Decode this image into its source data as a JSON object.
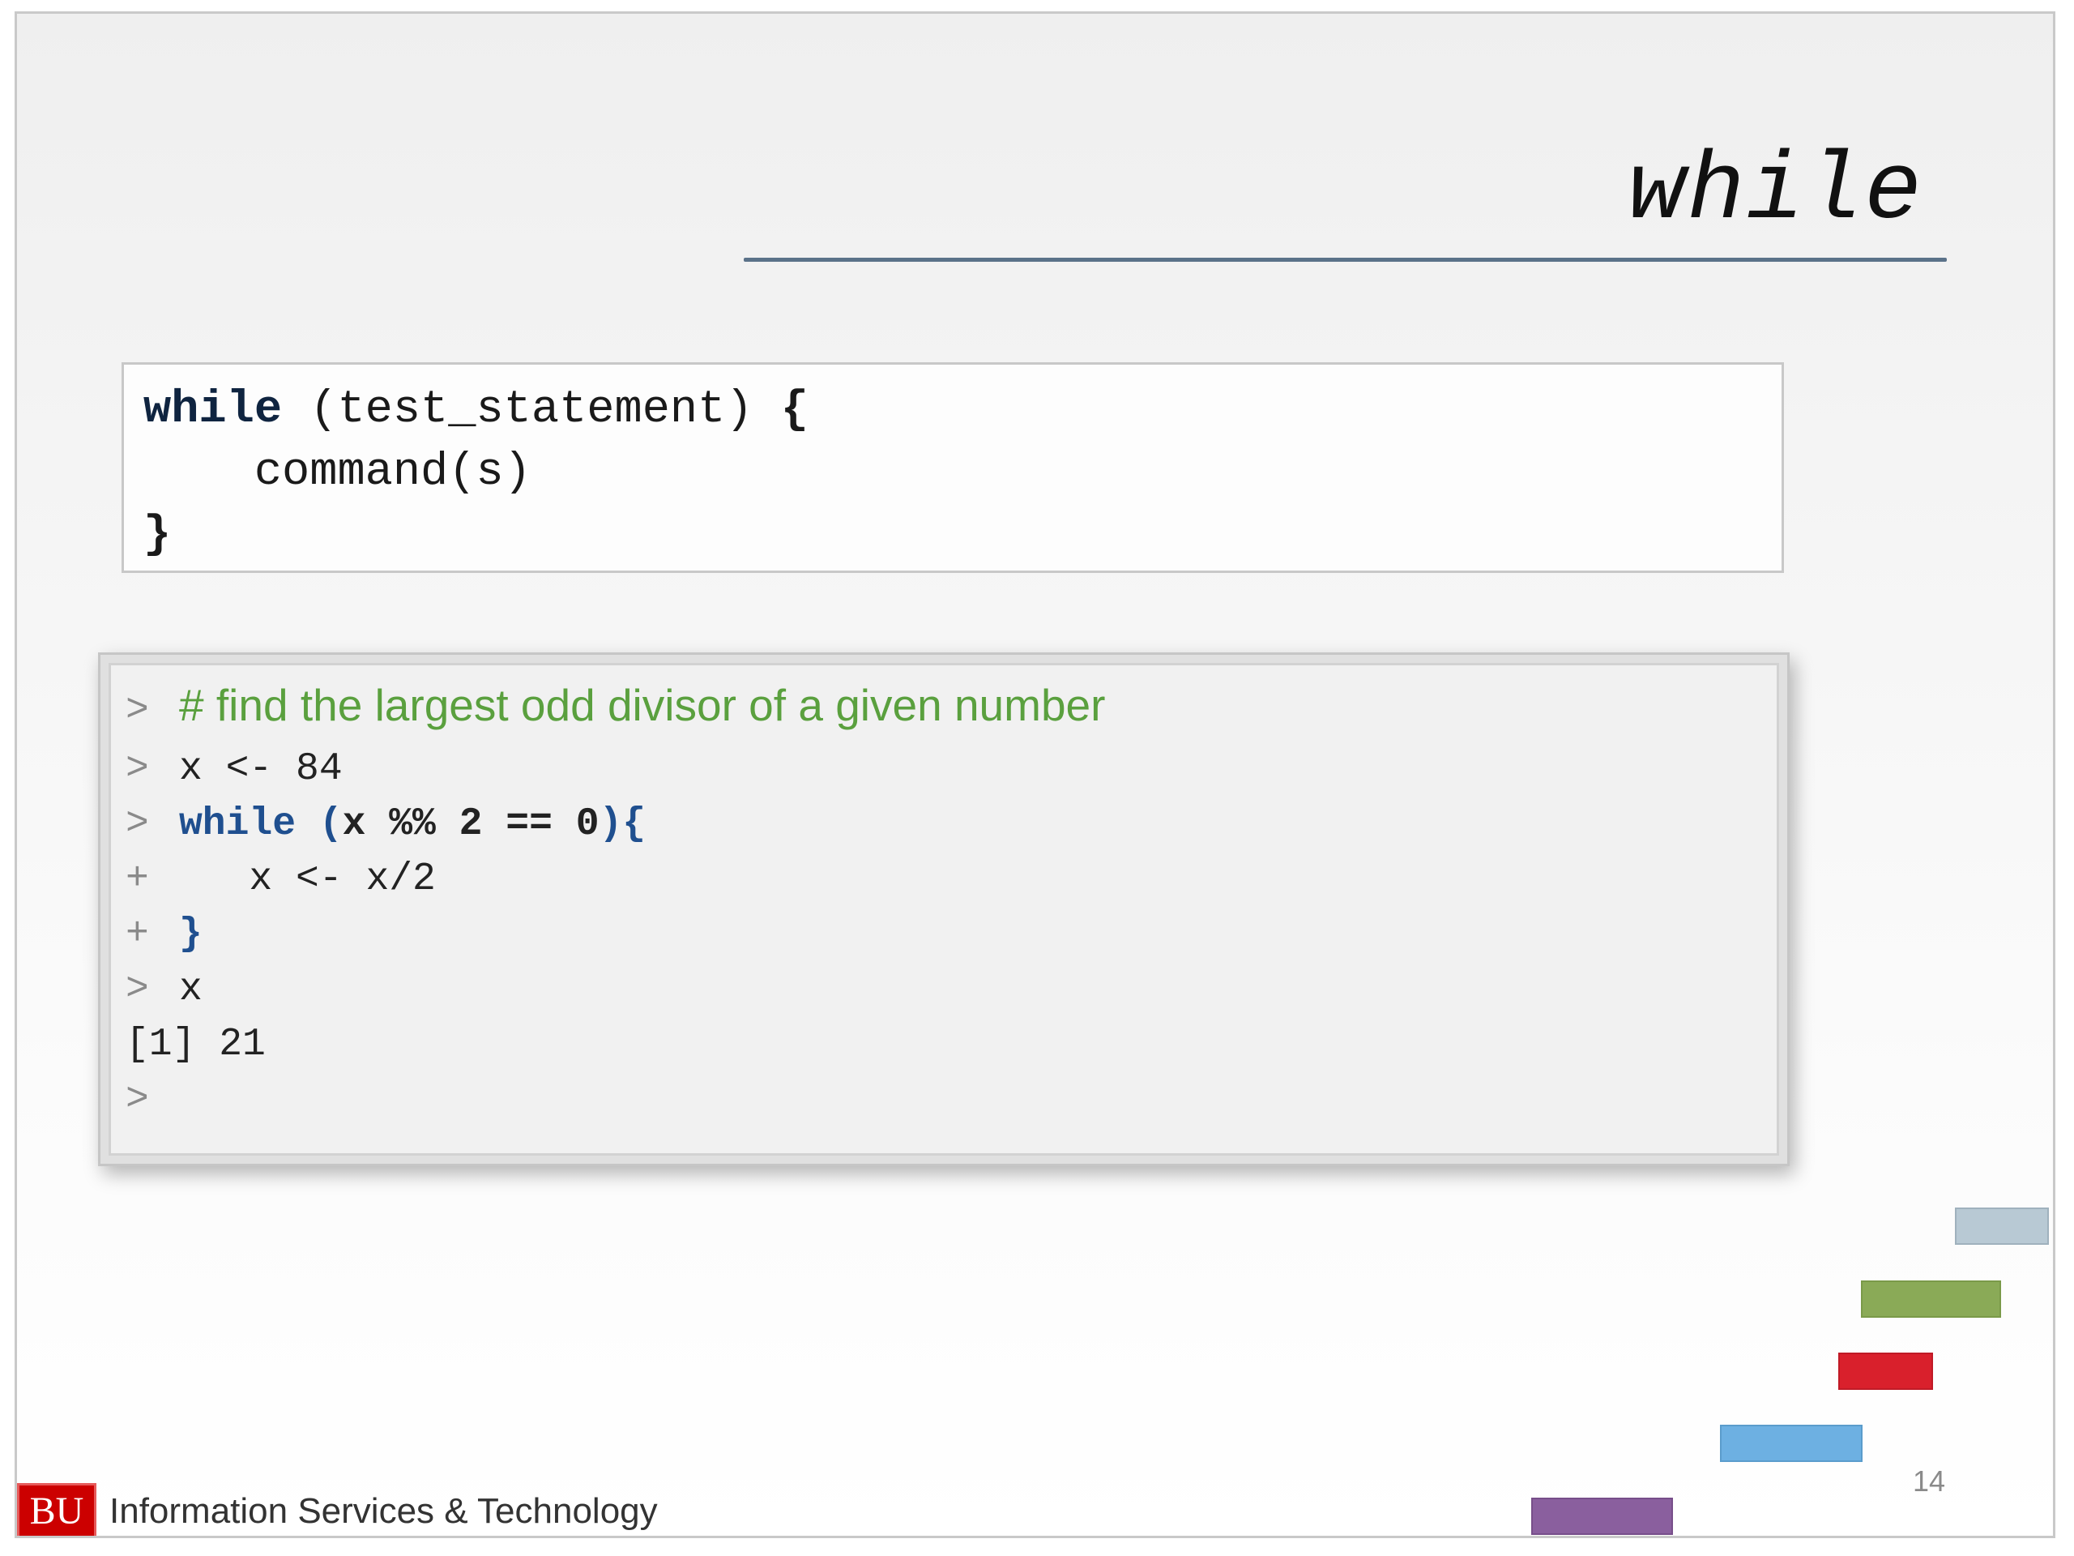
{
  "slide": {
    "title": "while",
    "page_number": "14"
  },
  "syntax": {
    "line1_keyword": "while",
    "line1_rest": " (test_statement) ",
    "line1_brace": "{",
    "line2": "    command(s)",
    "line3": "}"
  },
  "console": {
    "prompt": ">",
    "continuation": "+",
    "comment": "# find the largest odd divisor of a given number",
    "assign": "x <- 84",
    "while_keyword": "while",
    "while_cond_open": " (",
    "while_cond_body": "x %% 2 == 0",
    "while_cond_close": "){",
    "body": "   x <- x/2",
    "close_brace": "}",
    "print_cmd": "x",
    "output": "[1] 21"
  },
  "footer": {
    "logo_text": "BU",
    "org_name": "Information Services & Technology"
  },
  "decor": {
    "bar_colors": [
      "#b8c9d4",
      "#8aaa57",
      "#d9202c",
      "#6db0e2",
      "#8a5f9e"
    ]
  }
}
